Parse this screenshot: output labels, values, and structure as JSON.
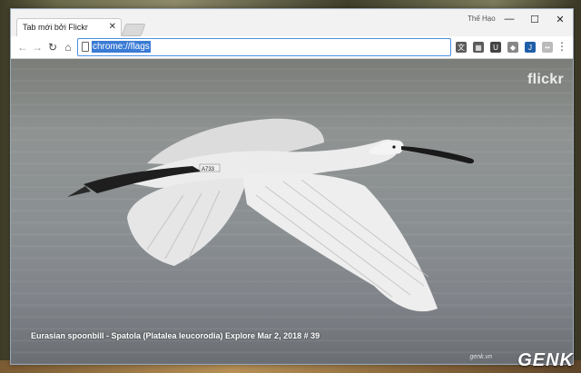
{
  "browser": {
    "tab_title": "Tab mới bởi Flickr",
    "tab_close": "✕",
    "profile_name": "Thế Hạo",
    "window_controls": {
      "minimize": "—",
      "maximize": "☐",
      "close": "✕"
    },
    "nav": {
      "back": "←",
      "forward": "→",
      "reload": "↻",
      "home": "⌂"
    },
    "url": "chrome://flags",
    "extensions": [
      {
        "name": "translate-icon",
        "color": "#5a5a5a",
        "glyph": "文"
      },
      {
        "name": "qr-icon",
        "color": "#5a5a5a",
        "glyph": "▦"
      },
      {
        "name": "shield-icon",
        "color": "#444444",
        "glyph": "U"
      },
      {
        "name": "cube-icon",
        "color": "#888888",
        "glyph": "◆"
      },
      {
        "name": "j-extension-icon",
        "color": "#1f5fa8",
        "glyph": "J"
      },
      {
        "name": "dots-extension-icon",
        "color": "#bbbbbb",
        "glyph": "••"
      }
    ],
    "menu": "⋮"
  },
  "page": {
    "logo": "flickr",
    "caption": "Eurasian spoonbill - Spatola (Platalea leucorodia) Explore Mar 2, 2018 # 39",
    "ring_text": "A733"
  },
  "watermark": {
    "brand": "GENK",
    "subtext": "genk.vn"
  },
  "colors": {
    "accent": "#3a7bd5",
    "omnibox_border": "#4a90e2"
  }
}
